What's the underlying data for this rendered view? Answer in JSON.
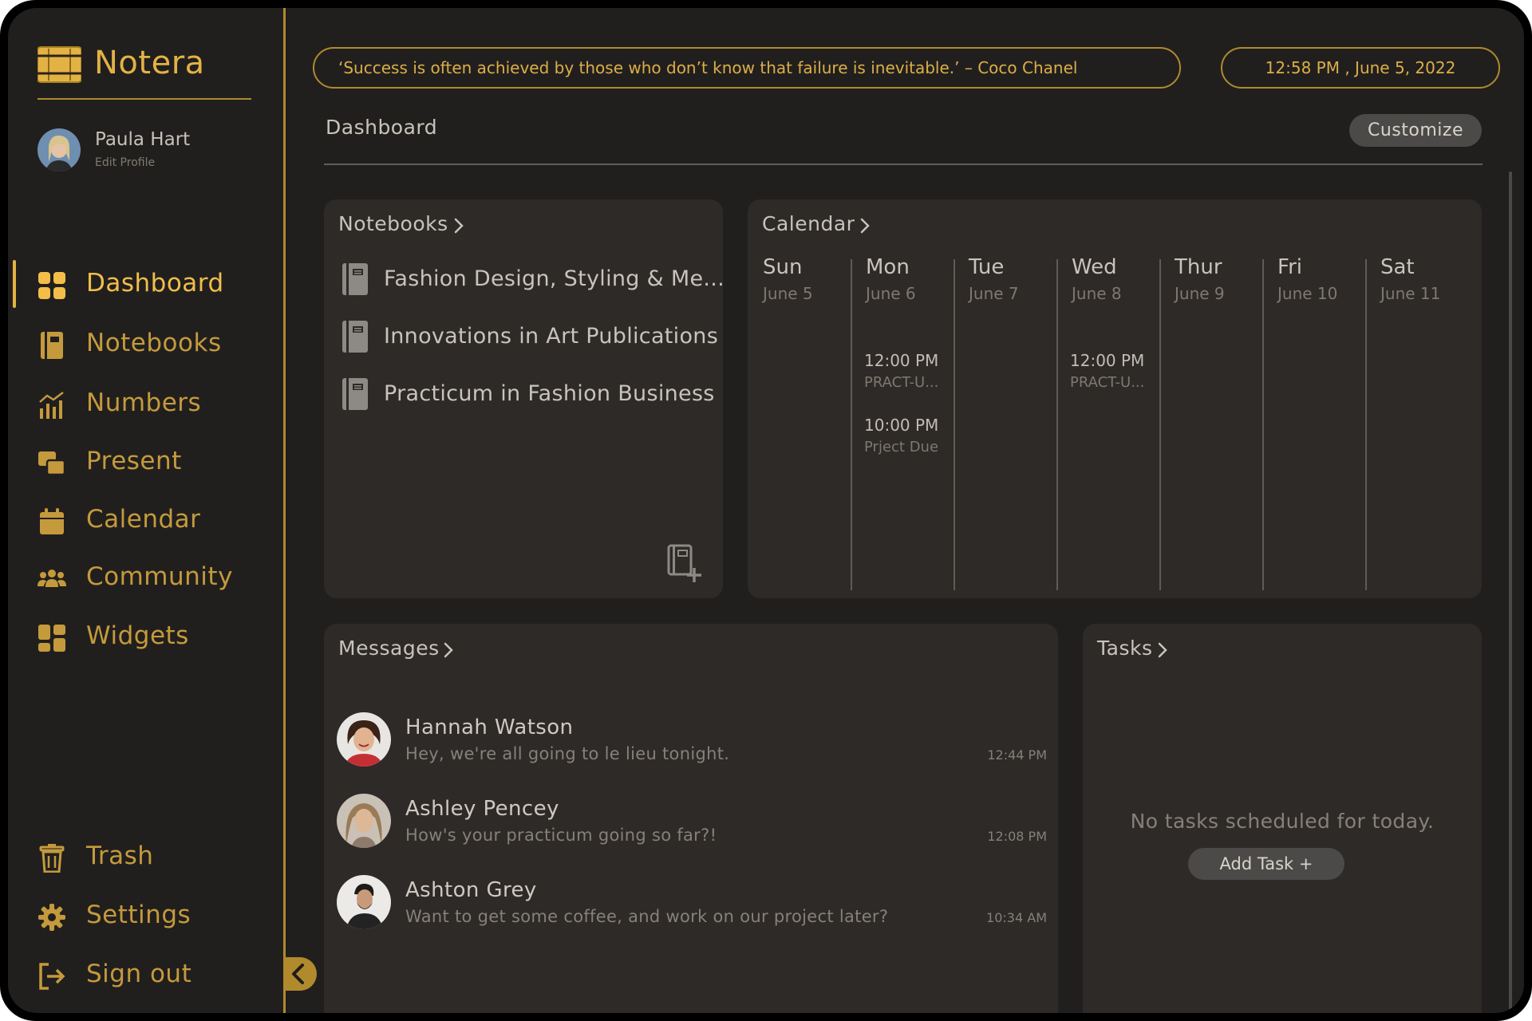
{
  "app": {
    "name": "Notera"
  },
  "profile": {
    "name": "Paula Hart",
    "edit_label": "Edit Profile"
  },
  "nav": {
    "main": [
      {
        "label": "Dashboard",
        "icon": "dashboard-icon",
        "active": true
      },
      {
        "label": "Notebooks",
        "icon": "notebook-icon"
      },
      {
        "label": "Numbers",
        "icon": "chart-icon"
      },
      {
        "label": "Present",
        "icon": "present-icon"
      },
      {
        "label": "Calendar",
        "icon": "calendar-icon"
      },
      {
        "label": "Community",
        "icon": "community-icon"
      },
      {
        "label": "Widgets",
        "icon": "widgets-icon"
      }
    ],
    "bottom": [
      {
        "label": "Trash",
        "icon": "trash-icon"
      },
      {
        "label": "Settings",
        "icon": "gear-icon"
      },
      {
        "label": "Sign out",
        "icon": "sign-out-icon"
      }
    ]
  },
  "header": {
    "quote": "‘Success is often achieved by those who don’t know that failure is inevitable.’ – Coco Chanel",
    "datetime": "12:58 PM ,  June 5, 2022",
    "page_title": "Dashboard",
    "customize_label": "Customize"
  },
  "notebooks": {
    "title": "Notebooks",
    "items": [
      "Fashion Design, Styling & Me...",
      "Innovations in Art Publications",
      "Practicum in Fashion Business"
    ]
  },
  "calendar": {
    "title": "Calendar",
    "days": [
      {
        "name": "Sun",
        "date": "June 5",
        "events": []
      },
      {
        "name": "Mon",
        "date": "June 6",
        "events": [
          {
            "time": "12:00 PM",
            "title": "PRACT-U..."
          },
          {
            "time": "10:00 PM",
            "title": "Prject Due"
          }
        ]
      },
      {
        "name": "Tue",
        "date": "June 7",
        "events": []
      },
      {
        "name": "Wed",
        "date": "June 8",
        "events": [
          {
            "time": "12:00 PM",
            "title": "PRACT-U..."
          }
        ]
      },
      {
        "name": "Thur",
        "date": "June 9",
        "events": []
      },
      {
        "name": "Fri",
        "date": "June 10",
        "events": []
      },
      {
        "name": "Sat",
        "date": "June 11",
        "events": []
      }
    ]
  },
  "messages": {
    "title": "Messages",
    "items": [
      {
        "name": "Hannah Watson",
        "text": "Hey, we're all going to le lieu tonight.",
        "time": "12:44 PM"
      },
      {
        "name": "Ashley Pencey",
        "text": "How's your practicum going so far?!",
        "time": "12:08 PM"
      },
      {
        "name": "Ashton Grey",
        "text": "Want to get some coffee, and work on our project later?",
        "time": "10:34 AM"
      }
    ]
  },
  "tasks": {
    "title": "Tasks",
    "empty_text": "No tasks scheduled for today.",
    "add_label": "Add Task +"
  },
  "colors": {
    "background": "#211f1e",
    "card": "#2d2a28",
    "accent": "#e3b245",
    "accent_dim": "#b08a2c",
    "text": "#c8c3bb",
    "muted": "#7e7870"
  }
}
